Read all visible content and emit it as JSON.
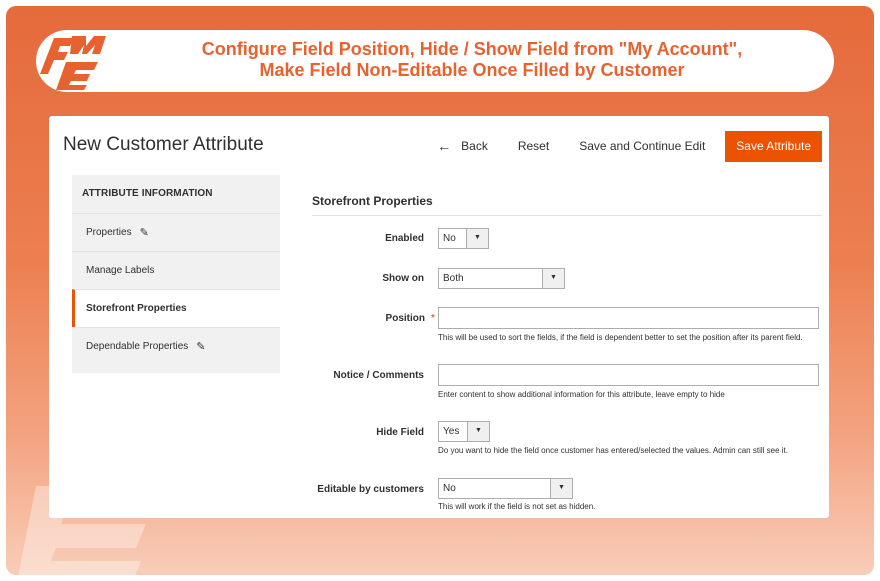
{
  "banner": {
    "title_line1": "Configure Field Position, Hide / Show Field from \"My Account\",",
    "title_line2": "Make Field Non-Editable Once Filled by Customer",
    "logo_text": "FME"
  },
  "page": {
    "title": "New Customer Attribute"
  },
  "actions": {
    "back_label": "Back",
    "reset_label": "Reset",
    "save_continue_label": "Save and Continue Edit",
    "save_label": "Save Attribute"
  },
  "sidebar": {
    "heading": "ATTRIBUTE INFORMATION",
    "items": [
      {
        "label": "Properties",
        "editable": true
      },
      {
        "label": "Manage Labels",
        "editable": false
      },
      {
        "label": "Storefront Properties",
        "editable": false,
        "active": true
      },
      {
        "label": "Dependable Properties",
        "editable": true
      }
    ]
  },
  "form": {
    "section_title": "Storefront Properties",
    "enabled": {
      "label": "Enabled",
      "value": "No"
    },
    "show_on": {
      "label": "Show on",
      "value": "Both"
    },
    "position": {
      "label": "Position",
      "value": "",
      "note": "This will be used to sort the fields, if the field is dependent better to set the position after its parent field."
    },
    "notice": {
      "label": "Notice / Comments",
      "value": "",
      "note": "Enter content to show additional information for this attribute, leave empty to hide"
    },
    "hide_field": {
      "label": "Hide Field",
      "value": "Yes",
      "note": "Do you want to hide the field once customer has entered/selected the values. Admin can still see it."
    },
    "editable": {
      "label": "Editable by customers",
      "value": "No",
      "note": "This will work if the field is not set as hidden."
    }
  },
  "colors": {
    "accent": "#eb5202",
    "banner_text": "#e8622f",
    "background": "#e56a3c"
  }
}
